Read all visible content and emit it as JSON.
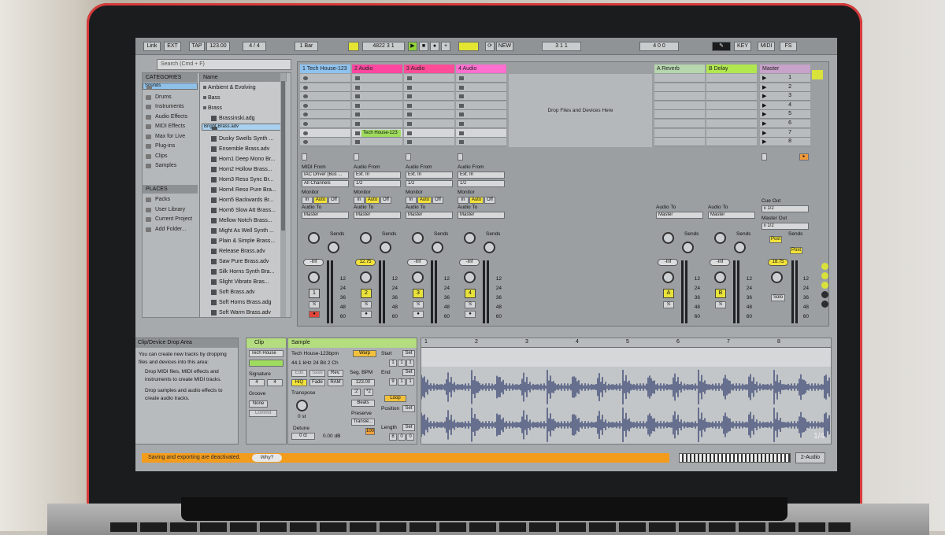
{
  "toolbar": {
    "link": "Link",
    "ext": "EXT",
    "tap": "TAP",
    "tempo": "123.00",
    "sig": "4 / 4",
    "bar": "1 Bar",
    "position": "4822   3   1",
    "new": "NEW",
    "loop_start": "3   1   1",
    "loop_len": "4   0   0",
    "key": "KEY",
    "midi": "MIDI",
    "fs": "FS"
  },
  "browser": {
    "search_placeholder": "Search (Cmd + F)",
    "categories_label": "CATEGORIES",
    "name_label": "Name",
    "places_label": "PLACES",
    "categories": [
      "Sounds",
      "Drums",
      "Instruments",
      "Audio Effects",
      "MIDI Effects",
      "Max for Live",
      "Plug-ins",
      "Clips",
      "Samples"
    ],
    "places": [
      "Packs",
      "User Library",
      "Current Project",
      "Add Folder..."
    ],
    "names": [
      "Ambient & Evolving",
      "Bass",
      "Brass",
      "Brassinski.adg",
      "Bright Brass.adv",
      "Dusky Swells Synth ...",
      "Ensemble Brass.adv",
      "Horn1 Deep Mono Br...",
      "Horn2 Hollow Brass...",
      "Horn3 Reso Sync Br...",
      "Horn4 Reso Pure Bra...",
      "Horn5 Backwards Br...",
      "Horn6 Slow Att Brass...",
      "Mellow Notch Brass...",
      "Might As Well Synth ...",
      "Plain & Simple Brass...",
      "Release Brass.adv",
      "Saw Pure Brass.adv",
      "Silk Horns Synth Bra...",
      "Slight Vibrato Bras...",
      "Soft Brass.adv",
      "Soft Horns Brass.adg",
      "Soft Warm Brass.adv"
    ]
  },
  "tracks": [
    {
      "name": "1 Tech House-123",
      "color": "#8fc3ef",
      "num": "1",
      "vol": "-Inf"
    },
    {
      "name": "2 Audio",
      "color": "#ff47a0",
      "num": "2",
      "vol": "12.75"
    },
    {
      "name": "3 Audio",
      "color": "#ff4c98",
      "num": "3",
      "vol": "-Inf"
    },
    {
      "name": "4 Audio",
      "color": "#ff6fd0",
      "num": "4",
      "vol": "-Inf"
    }
  ],
  "returns": [
    {
      "name": "A Reverb",
      "color": "#b6d6ae",
      "letter": "A"
    },
    {
      "name": "B Delay",
      "color": "#b1e84f",
      "letter": "B"
    }
  ],
  "master": {
    "name": "Master",
    "scenes": [
      "1",
      "2",
      "3",
      "4",
      "5",
      "6",
      "7",
      "8"
    ],
    "vol": "18.75",
    "cue": "Cue Out",
    "cue_val": "ii 1/2",
    "master_out": "Master Out",
    "master_val": "ii 1/2",
    "post": "Post",
    "solo": "Solo"
  },
  "session": {
    "drop": "Drop Files and Devices Here",
    "clip_name": "Tech House-123",
    "midi_from": "MIDI From",
    "audio_from": "Audio From",
    "monitor": "Monitor",
    "audio_to": "Audio To",
    "sends": "Sends",
    "in": "In",
    "auto": "Auto",
    "off": "Off",
    "iac": "IAC Driver (Bus ...",
    "all_channels": "All Channels",
    "ext_in": "Ext. In",
    "half": "1/2",
    "master": "Master",
    "scale": [
      "12",
      "24",
      "36",
      "48",
      "60"
    ]
  },
  "info": {
    "title": "Clip/Device Drop Area",
    "body1": "You can create new tracks by dropping files and devices into this area:",
    "b1": "Drop MIDI files, MIDI effects and instruments to create MIDI tracks.",
    "b2": "Drop samples and audio effects to create audio tracks."
  },
  "clip": {
    "label": "Clip",
    "name": "Tech House",
    "signature": "Signature",
    "sig_n": "4",
    "sig_d": "4",
    "groove": "Groove",
    "none": "None",
    "commit": "Commit"
  },
  "sample": {
    "label": "Sample",
    "file": "Tech House-123bpm",
    "format": "44.1 kHz 24 Bit 2 Ch",
    "warp": "Warp",
    "edit": "Edit",
    "save": "Save",
    "rev": "Rev.",
    "hiq": "HiQ",
    "fade": "Fade",
    "ram": "RAM",
    "transpose": "Transpose",
    "st": "0 st",
    "detune": "Detune",
    "ct": "0 ct",
    "db": "0.00 dB",
    "seg_bpm": "Seg. BPM",
    "bpm": "123.00",
    "start": "Start",
    "end": "End",
    "loop": "Loop",
    "position": "Position",
    "length": "Length",
    "set": "Set",
    "beats": "Beats",
    "preserve": "Preserve",
    "transients": "Transie...",
    "hundred": "100",
    "start_val": [
      "1",
      "1",
      "1"
    ],
    "end_val": [
      "9",
      "1",
      "1"
    ],
    "len_val": [
      "8",
      "0",
      "0"
    ],
    "half": ":2",
    "double": "*2"
  },
  "wave": {
    "ruler": [
      "1",
      "2",
      "3",
      "4",
      "5",
      "6",
      "7",
      "8"
    ],
    "page": "1/4"
  },
  "status": {
    "message": "Saving and exporting are deactivated.",
    "why": "Why?",
    "track": "2-Audio"
  }
}
